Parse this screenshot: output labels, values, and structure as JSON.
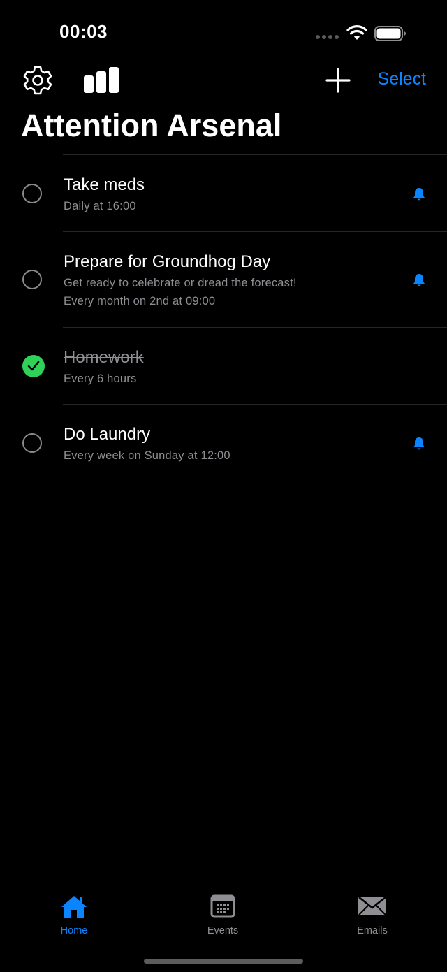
{
  "status_bar": {
    "time": "00:03"
  },
  "nav": {
    "select_label": "Select"
  },
  "page": {
    "title": "Attention Arsenal"
  },
  "tasks": [
    {
      "title": "Take meds",
      "subtitle": "Daily at 16:00",
      "completed": false,
      "has_alert": true
    },
    {
      "title": "Prepare for Groundhog Day",
      "note": "Get ready to celebrate or dread the forecast!",
      "subtitle": "Every month on 2nd at 09:00",
      "completed": false,
      "has_alert": true
    },
    {
      "title": "Homework",
      "subtitle": "Every 6 hours",
      "completed": true,
      "has_alert": false
    },
    {
      "title": "Do Laundry",
      "subtitle": "Every week on Sunday at 12:00",
      "completed": false,
      "has_alert": true
    }
  ],
  "tab_bar": {
    "tabs": [
      {
        "label": "Home",
        "icon": "house-icon",
        "active": true
      },
      {
        "label": "Events",
        "icon": "calendar-icon",
        "active": false
      },
      {
        "label": "Emails",
        "icon": "envelope-icon",
        "active": false
      }
    ]
  },
  "colors": {
    "accent": "#0a84ff",
    "complete": "#30d158",
    "secondary_text": "#8e8e93",
    "background": "#000000"
  }
}
